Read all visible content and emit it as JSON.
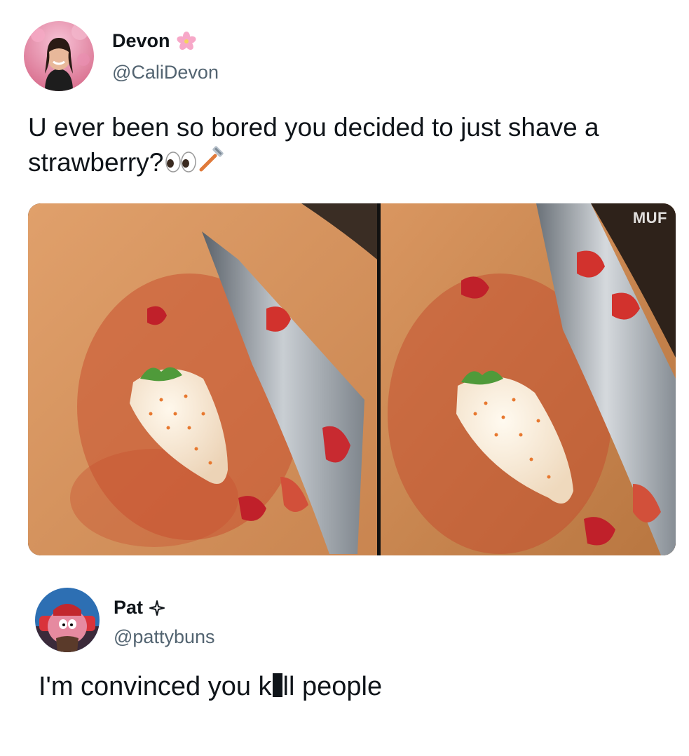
{
  "post": {
    "author_name": "Devon",
    "author_handle": "@CaliDevon",
    "author_badge_icon": "cherry-blossom-icon",
    "text": "U ever been so bored you decided to just shave a strawberry?",
    "text_emoji_icons": [
      "eyes-icon",
      "razor-icon"
    ],
    "media_watermark": "MUF"
  },
  "reply": {
    "author_name": "Pat",
    "author_handle": "@pattybuns",
    "author_badge_icon": "sparkle-star-icon",
    "text_before": "I'm convinced you k",
    "text_after": "ll people"
  },
  "colors": {
    "text_primary": "#0f1419",
    "text_secondary": "#536471",
    "background": "#ffffff"
  }
}
